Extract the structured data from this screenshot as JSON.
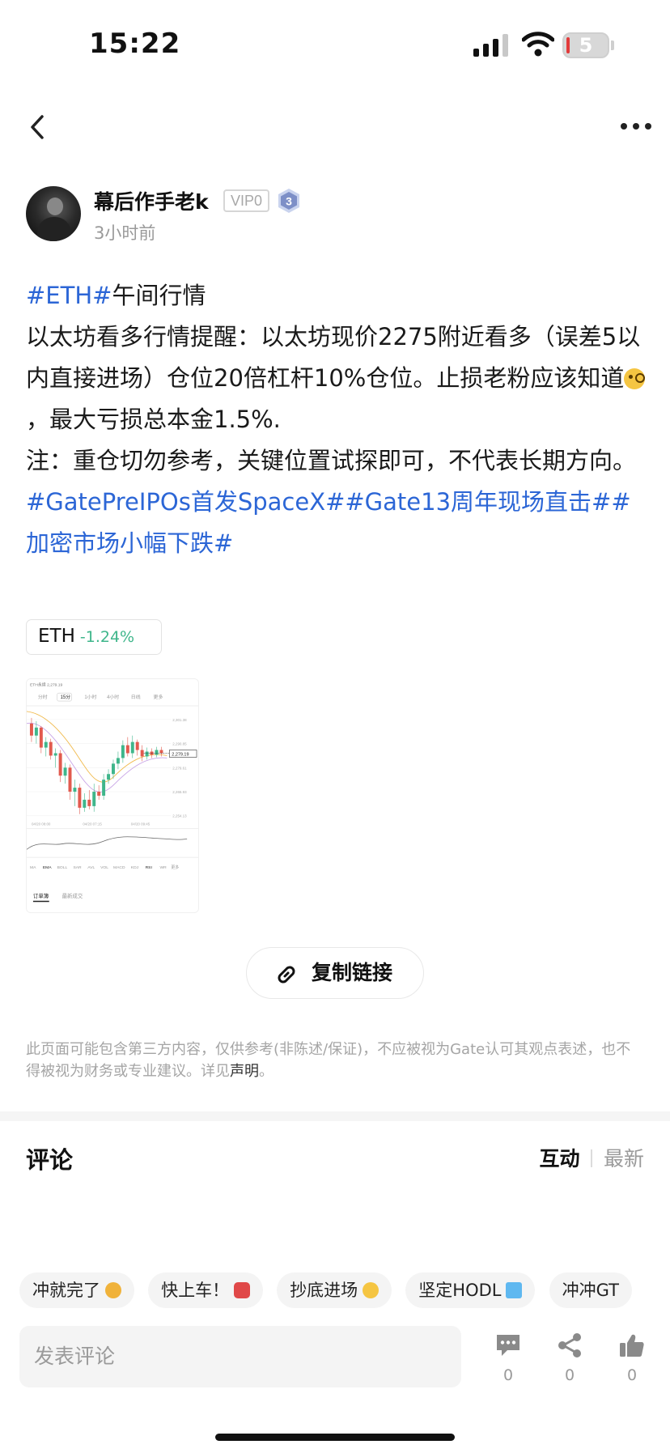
{
  "status_bar": {
    "time": "15:22",
    "battery": "5"
  },
  "author": {
    "name": "幕后作手老k",
    "vip": "VIP0",
    "level": "3",
    "time_ago": "3小时前"
  },
  "post": {
    "tag_eth": "#ETH#",
    "line1_title": "午间行情",
    "para1_before_emoji": "以太坊看多行情提醒：以太坊现价2275附近看多（误差5以内直接进场）仓位20倍杠杆10%仓位。止损老粉应该知道",
    "para1_after_emoji": "，最大亏损总本金1.5%.",
    "para2": "注：重仓切勿参考，关键位置试探即可，不代表长期方向。",
    "tags": [
      "#GatePreIPOs首发SpaceX#",
      "#Gate13周年现场直击#",
      "#加密市场小幅下跌#"
    ]
  },
  "coin_chip": {
    "symbol": "ETH",
    "change": "-1.24%",
    "change_color": "#3fb68b"
  },
  "chart_thumbnail": {
    "title": "ETH永续 2,279.19",
    "tabs": [
      "分时",
      "15分",
      "1小时",
      "4小时",
      "日线",
      "更多"
    ],
    "bottom_indicators": [
      "MA",
      "EMA",
      "BOLL",
      "SAR",
      "AVL",
      "VOL",
      "MACD",
      "KDJ",
      "RSI",
      "WR",
      "更多"
    ],
    "bottom_tabs": [
      "订单簿",
      "最新成交"
    ]
  },
  "copy_link_label": "复制链接",
  "disclaimer": {
    "text": "此页面可能包含第三方内容，仅供参考(非陈述/保证)，不应被视为Gate认可其观点表述，也不得被视为财务或专业建议。详见",
    "link": "声明",
    "end": "。"
  },
  "comments": {
    "title": "评论",
    "sort_active": "互动",
    "sort_inactive": "最新"
  },
  "quick_replies": [
    {
      "label": "冲就完了",
      "emoji": "fist-emoji"
    },
    {
      "label": "快上车！",
      "emoji": "car-emoji"
    },
    {
      "label": "抄底进场",
      "emoji": "sunglasses-emoji"
    },
    {
      "label": "坚定HODL",
      "emoji": "gem-emoji"
    },
    {
      "label": "冲冲GT",
      "emoji": ""
    }
  ],
  "comment_input": {
    "placeholder": "发表评论"
  },
  "actions": {
    "comments": "0",
    "shares": "0",
    "likes": "0"
  },
  "colors": {
    "tag_blue": "#2c66d6",
    "up_green": "#3fb68b",
    "down_red": "#e25a4e"
  }
}
